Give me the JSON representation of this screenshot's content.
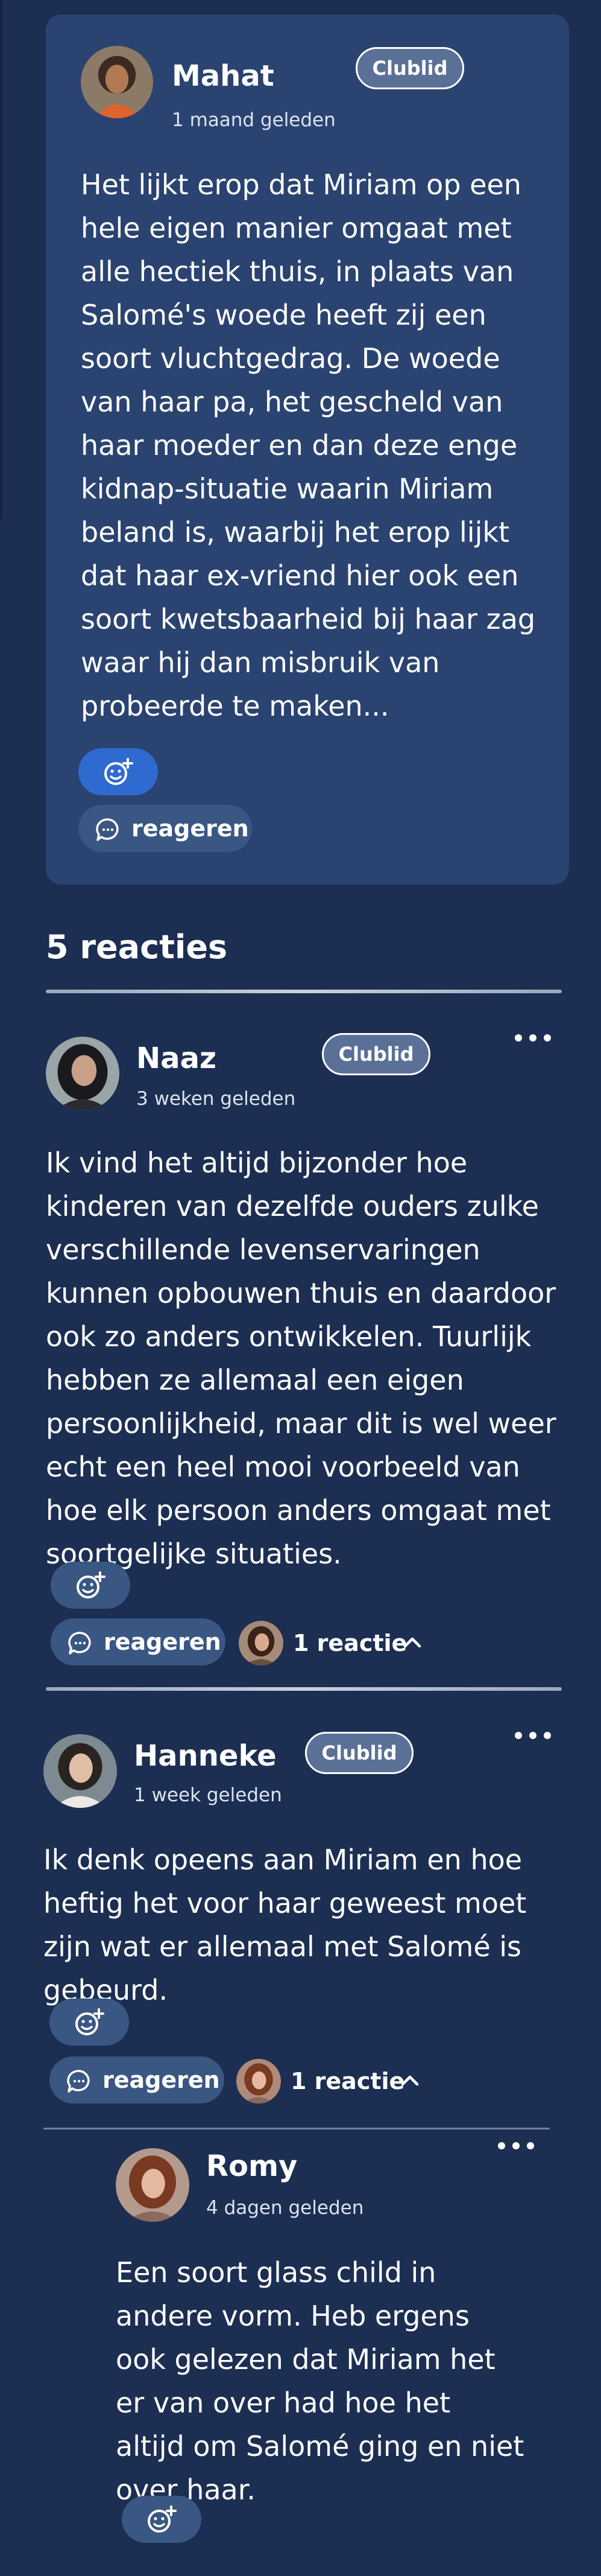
{
  "featured": {
    "author": "Mahat",
    "badge": "Clublid",
    "time": "1 maand geleden",
    "body": "Het lijkt erop dat Miriam op een hele eigen manier omgaat met alle hectiek thuis, in plaats van Salomé's woede heeft zij een soort vluchtgedrag. De woede van haar pa, het gescheld van haar moeder en dan deze enge kidnap-situatie waarin Miriam beland is, waarbij het erop lijkt dat haar ex-vriend hier ook een soort kwetsbaarheid bij haar zag waar hij dan misbruik van probeerde te maken...",
    "react_icon": "smiley-plus-icon",
    "reply_label": "reageren",
    "reply_icon": "chat-bubble-icon"
  },
  "reactions_heading": "5 reacties",
  "comments": [
    {
      "author": "Naaz",
      "badge": "Clublid",
      "time": "3 weken geleden",
      "body": "Ik vind het altijd bijzonder hoe kinderen van dezelfde ouders zulke verschillende levenservaringen kunnen opbouwen thuis en daardoor ook zo anders ontwikkelen. Tuurlijk hebben ze allemaal een eigen persoonlijkheid, maar dit is wel weer echt een heel mooi voorbeeld van hoe elk persoon anders omgaat met soortgelijke situaties.",
      "reply_label": "reageren",
      "replies_count": "1 reactie"
    },
    {
      "author": "Hanneke",
      "badge": "Clublid",
      "time": "1 week geleden",
      "body": "Ik denk opeens aan Miriam en hoe heftig het voor haar geweest moet zijn wat er allemaal met Salomé is gebeurd.",
      "reply_label": "reageren",
      "replies_count": "1 reactie"
    }
  ],
  "reply": {
    "author": "Romy",
    "time": "4 dagen geleden",
    "body": "Een soort glass child in andere vorm. Heb ergens ook gelezen dat Miriam het er van over had hoe het altijd om Salomé ging en niet over haar."
  },
  "colors": {
    "background": "#1c2f52",
    "card": "#2a4370",
    "pill": "#3a5683",
    "react_active": "#2f6ad1"
  }
}
